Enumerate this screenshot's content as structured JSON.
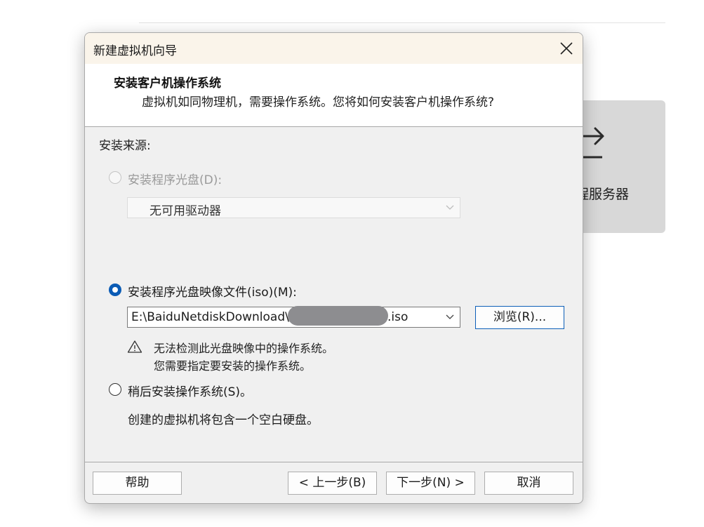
{
  "background": {
    "card_label": "程服务器"
  },
  "dialog": {
    "title": "新建虚拟机向导",
    "header": {
      "title": "安装客户机操作系统",
      "subtitle": "虚拟机如同物理机，需要操作系统。您将如何安装客户机操作系统?"
    },
    "source_label": "安装来源:",
    "option_disc": {
      "label": "安装程序光盘(D):",
      "selected": false,
      "enabled": false,
      "dropdown_value": "无可用驱动器"
    },
    "option_iso": {
      "label": "安装程序光盘映像文件(iso)(M):",
      "selected": true,
      "path_prefix": "E:\\BaiduNetdiskDownload\\sh",
      "path_suffix": ".iso",
      "browse_label": "浏览(R)...",
      "warning_line1": "无法检测此光盘映像中的操作系统。",
      "warning_line2": "您需要指定要安装的操作系统。"
    },
    "option_later": {
      "label": "稍后安装操作系统(S)。",
      "selected": false,
      "description": "创建的虚拟机将包含一个空白硬盘。"
    },
    "footer": {
      "help": "帮助",
      "back": "< 上一步(B)",
      "next": "下一步(N) >",
      "cancel": "取消"
    }
  },
  "colors": {
    "accent": "#0a5bb5",
    "titlebar": "#faf4ea",
    "dialog_bg": "#f0f0f0"
  }
}
